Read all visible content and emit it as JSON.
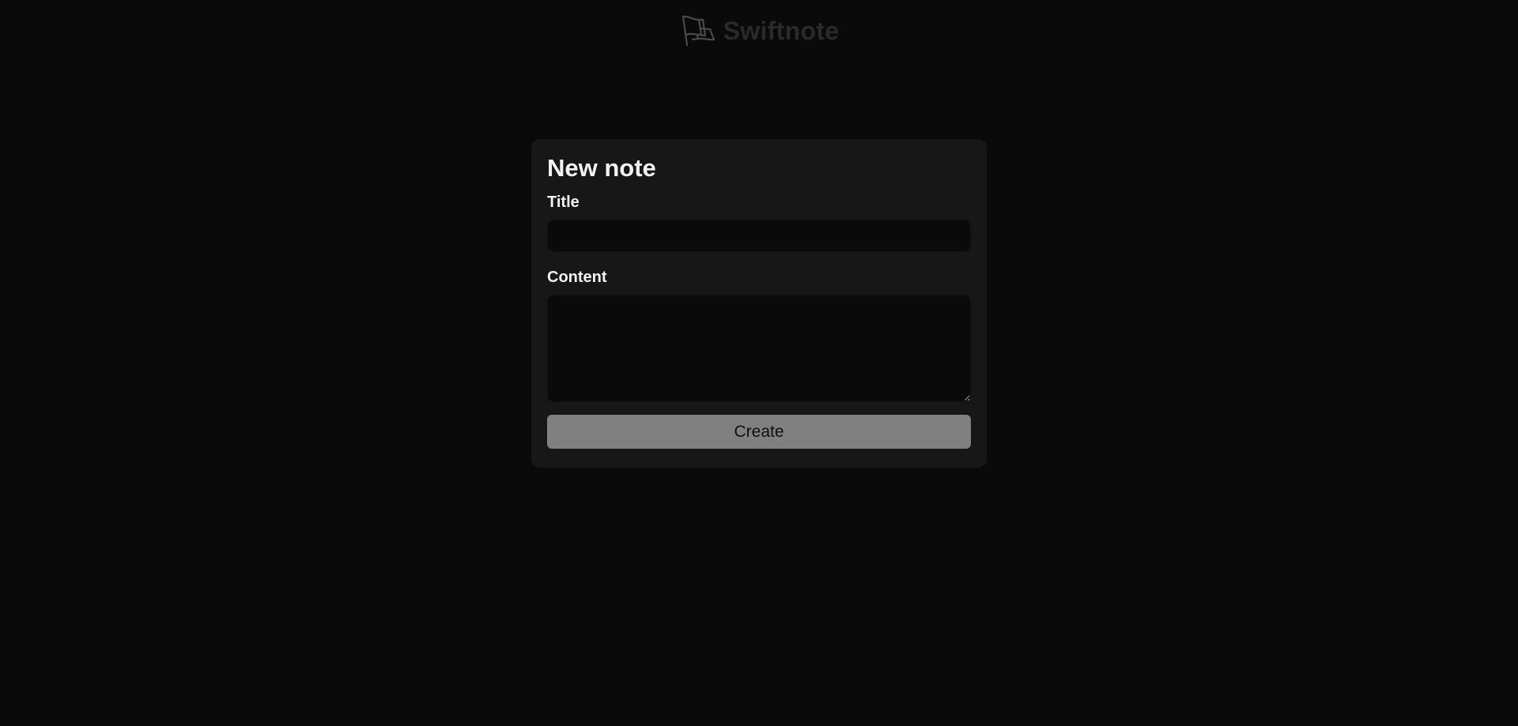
{
  "header": {
    "logo_icon": "flag-icon",
    "brand_name": "Swiftnote"
  },
  "form": {
    "heading": "New note",
    "title_label": "Title",
    "title_value": "",
    "content_label": "Content",
    "content_value": "",
    "submit_label": "Create"
  },
  "colors": {
    "background": "#0a0a0a",
    "card": "#171717",
    "input": "#0a0a0a",
    "button": "#808080",
    "text": "#f2f2f2",
    "brand_text": "#2a2a2a"
  }
}
